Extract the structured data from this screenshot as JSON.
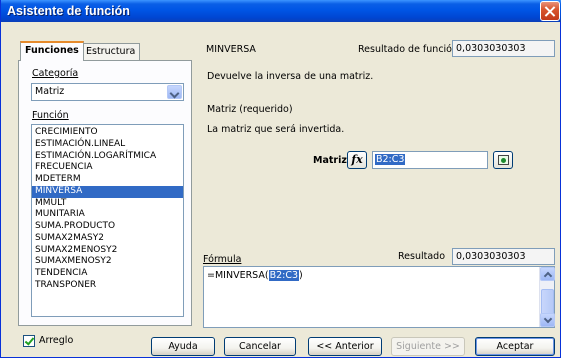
{
  "window": {
    "title": "Asistente de función"
  },
  "tabs": [
    {
      "label": "Funciones",
      "active": true
    },
    {
      "label": "Estructura",
      "active": false
    }
  ],
  "category": {
    "label": "Categoría",
    "value": "Matriz"
  },
  "function_list": {
    "label": "Función",
    "items": [
      "CRECIMIENTO",
      "ESTIMACIÓN.LINEAL",
      "ESTIMACIÓN.LOGARÍTMICA",
      "FRECUENCIA",
      "MDETERM",
      "MINVERSA",
      "MMULT",
      "MUNITARIA",
      "SUMA.PRODUCTO",
      "SUMAX2MASY2",
      "SUMAX2MENOSY2",
      "SUMAXMENOSY2",
      "TENDENCIA",
      "TRANSPONER"
    ],
    "selected": "MINVERSA"
  },
  "array_checkbox": {
    "label": "Arreglo",
    "checked": true
  },
  "function_info": {
    "name": "MINVERSA",
    "result_label": "Resultado de función",
    "result_value": "0,0303030303",
    "description": "Devuelve la inversa de una matriz.",
    "param_title": "Matriz (requerido)",
    "param_description": "La matriz que será invertida."
  },
  "matrix_arg": {
    "label": "Matriz",
    "fx_glyph": "fx",
    "value": "B2:C3"
  },
  "formula": {
    "label": "Fórmula",
    "result_label": "Resultado",
    "result_value": "0,0303030303",
    "text_prefix": "=MINVERSA(",
    "text_highlight": "B2:C3",
    "text_suffix": ")"
  },
  "buttons": {
    "help": "Ayuda",
    "cancel": "Cancelar",
    "back": "<< Anterior",
    "next": "Siguiente >>",
    "ok": "Aceptar"
  },
  "colors": {
    "titlebar": "#0055e5",
    "selection": "#316ac5",
    "dialog_bg": "#ece9d8",
    "close": "#d9562e"
  }
}
